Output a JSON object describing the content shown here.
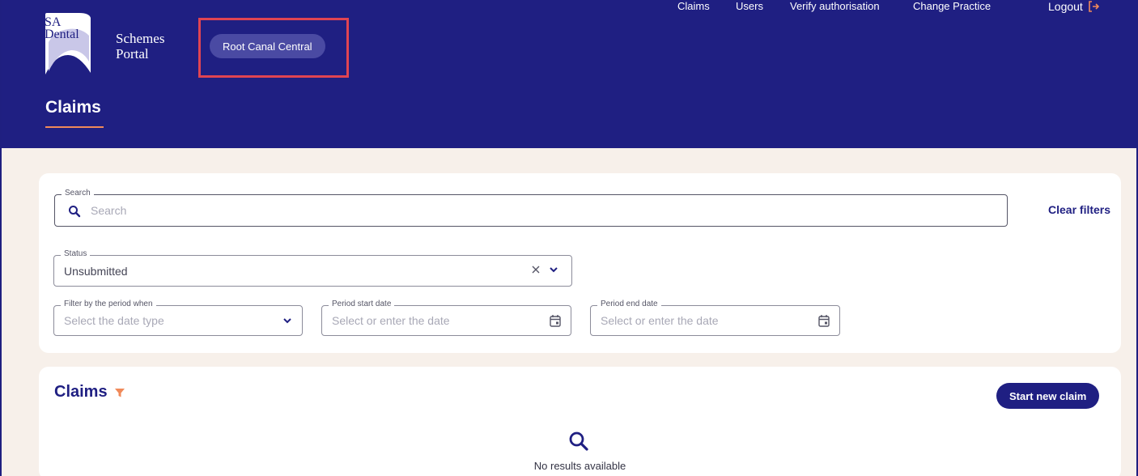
{
  "brand": {
    "logo_line1": "SA",
    "logo_line2": "Dental",
    "portal_line1": "Schemes",
    "portal_line2": "Portal",
    "practice": "Root Canal Central"
  },
  "nav": {
    "claims": "Claims",
    "users": "Users",
    "verify": "Verify authorisation",
    "change_practice": "Change Practice",
    "logout": "Logout"
  },
  "page": {
    "title": "Claims"
  },
  "filters": {
    "search": {
      "label": "Search",
      "placeholder": "Search"
    },
    "clear": "Clear filters",
    "status": {
      "label": "Status",
      "value": "Unsubmitted"
    },
    "date_type": {
      "label": "Filter by the period when",
      "placeholder": "Select the date type"
    },
    "start_date": {
      "label": "Period start date",
      "placeholder": "Select or enter the date"
    },
    "end_date": {
      "label": "Period end date",
      "placeholder": "Select or enter the date"
    }
  },
  "claims": {
    "heading": "Claims",
    "start_button": "Start new claim",
    "empty_message": "No results available"
  },
  "colors": {
    "primary": "#1f1f82",
    "accent": "#f08a5a",
    "page_bg": "#f7f0ea",
    "highlight": "#e04452"
  },
  "icons": [
    "search-icon",
    "clear-icon",
    "chevron-down-icon",
    "calendar-icon",
    "filter-icon",
    "logout-icon"
  ]
}
